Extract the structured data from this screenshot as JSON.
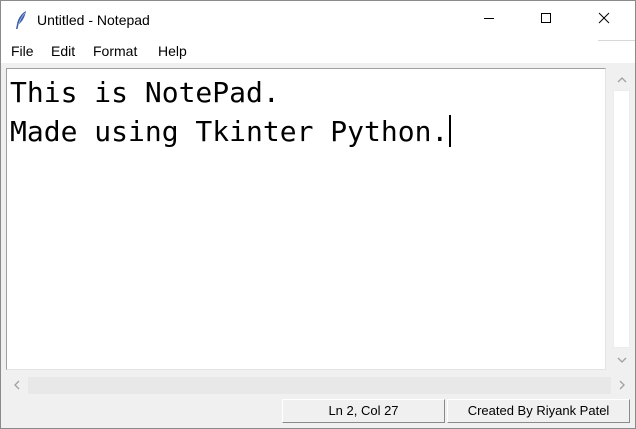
{
  "window": {
    "title": "Untitled - Notepad",
    "app_icon": "feather-icon",
    "controls": {
      "minimize_icon": "minimize-icon",
      "maximize_icon": "maximize-icon",
      "close_icon": "close-icon"
    }
  },
  "menu": {
    "items": [
      {
        "label": "File"
      },
      {
        "label": "Edit"
      },
      {
        "label": "Format"
      },
      {
        "label": "Help"
      }
    ]
  },
  "editor": {
    "lines": [
      "This is NotePad.",
      "Made using Tkinter Python."
    ]
  },
  "statusbar": {
    "position": "Ln 2, Col 27",
    "credit": "Created By Riyank Patel"
  },
  "scrollbars": {
    "vertical": {
      "up_icon": "chevron-up-icon",
      "down_icon": "chevron-down-icon"
    },
    "horizontal": {
      "left_icon": "chevron-left-icon",
      "right_icon": "chevron-right-icon"
    }
  }
}
